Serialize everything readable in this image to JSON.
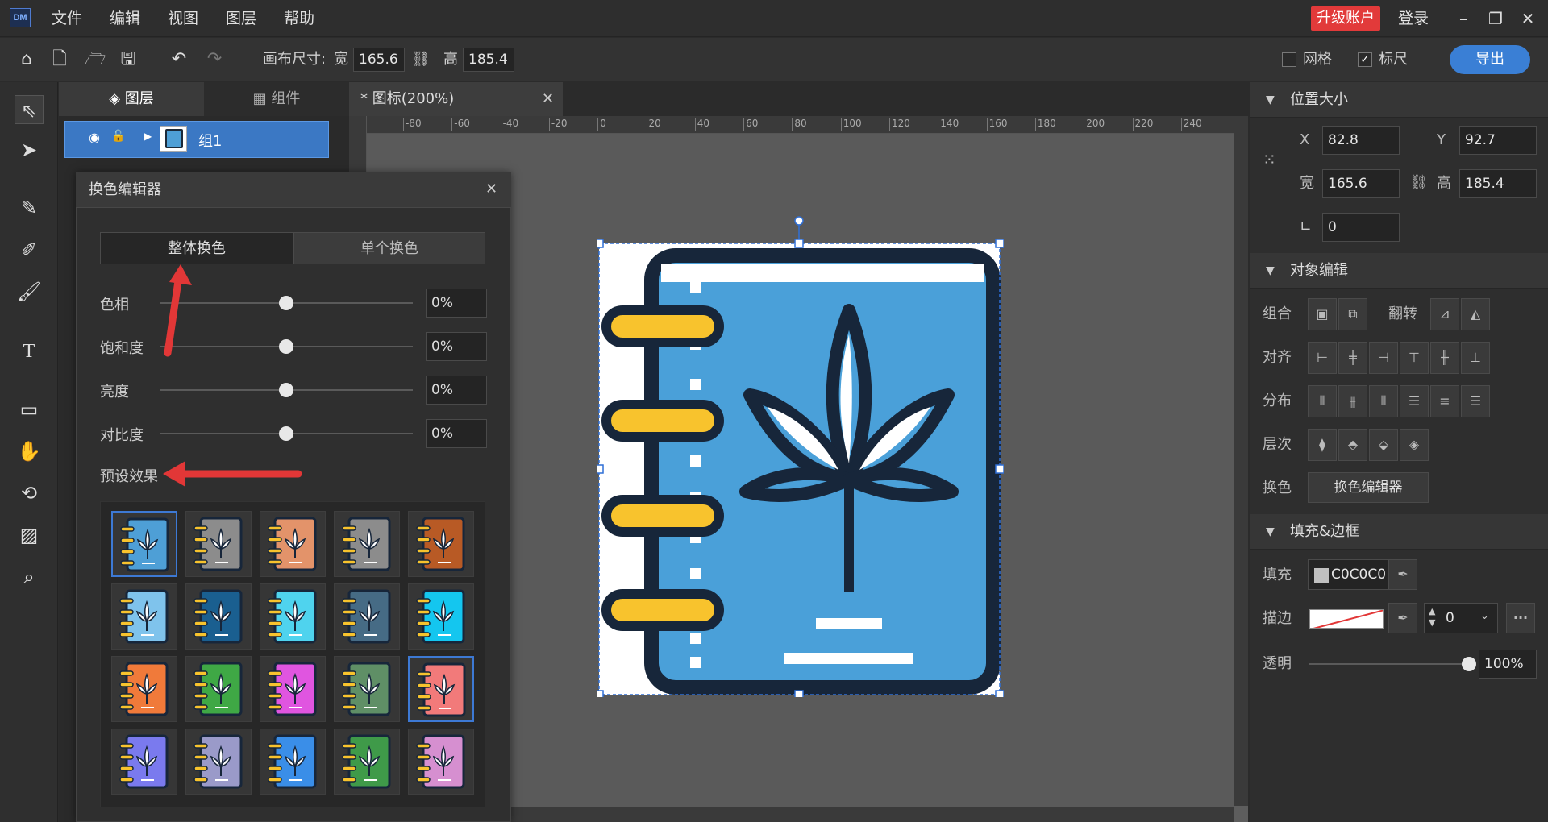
{
  "menu": {
    "items": [
      "文件",
      "编辑",
      "视图",
      "图层",
      "帮助"
    ],
    "upgrade": "升级账户",
    "login": "登录",
    "logo": "DM"
  },
  "toolbar": {
    "canvas_size_label": "画布尺寸:",
    "width_label": "宽",
    "width": "165.6",
    "height_label": "高",
    "height": "185.4",
    "grid": "网格",
    "ruler": "标尺",
    "ruler_checked": true,
    "export": "导出"
  },
  "tabs": {
    "layers": "图层",
    "components": "组件",
    "doc": "* 图标(200%)"
  },
  "layer": {
    "name": "组1"
  },
  "ruler": {
    "ticks": [
      "-80",
      "-60",
      "-40",
      "-20",
      "0",
      "20",
      "40",
      "60",
      "80",
      "100",
      "120",
      "140",
      "160",
      "180",
      "200",
      "220",
      "240"
    ]
  },
  "color_editor": {
    "title": "换色编辑器",
    "tab_whole": "整体换色",
    "tab_single": "单个换色",
    "sliders": [
      {
        "label": "色相",
        "value": "0%",
        "level": 0.5
      },
      {
        "label": "饱和度",
        "value": "0%",
        "level": 0.5
      },
      {
        "label": "亮度",
        "value": "0%",
        "level": 0.5
      },
      {
        "label": "对比度",
        "value": "0%",
        "level": 0.5
      }
    ],
    "preset_label": "预设效果",
    "presets": [
      [
        "#4e9fd6",
        "#8c8c8c",
        "#e3936a",
        "#8c8c8c",
        "#b85a25"
      ],
      [
        "#7fc3ec",
        "#1a5f90",
        "#4fd3ee",
        "#466b85",
        "#14c6ef"
      ],
      [
        "#f07a3a",
        "#3fa845",
        "#e055e0",
        "#5f8f66",
        "#f27a7a"
      ],
      [
        "#7a7aee",
        "#9a9ac9",
        "#3a8ee8",
        "#3f9a49",
        "#d68fd0"
      ]
    ]
  },
  "right": {
    "pos_size": "位置大小",
    "x_label": "X",
    "x": "82.8",
    "y_label": "Y",
    "y": "92.7",
    "w_label": "宽",
    "w": "165.6",
    "h_label": "高",
    "h": "185.4",
    "angle": "0",
    "obj_edit": "对象编辑",
    "group": "组合",
    "flip": "翻转",
    "align": "对齐",
    "distribute": "分布",
    "order": "层次",
    "recolor": "换色",
    "recolor_btn": "换色编辑器",
    "fill_border": "填充&边框",
    "fill": "填充",
    "fill_value": "C0C0C0",
    "fill_color": "#c0c0c0",
    "stroke": "描边",
    "stroke_width": "0",
    "opacity": "透明",
    "opacity_value": "100%",
    "opacity_level": 1.0
  }
}
